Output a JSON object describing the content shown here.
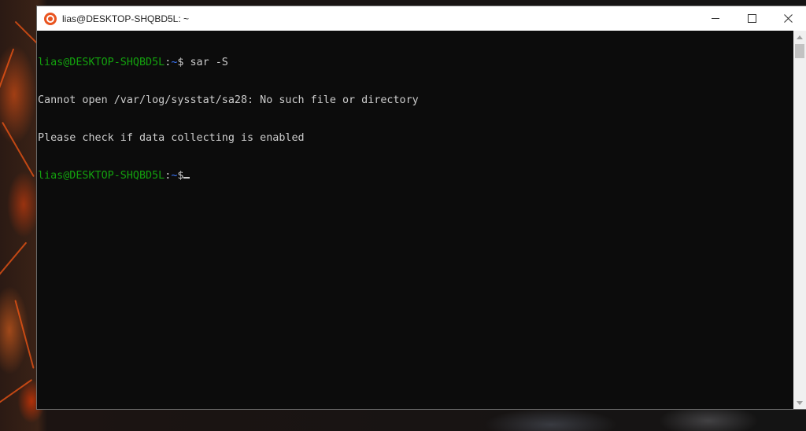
{
  "window": {
    "title": "lias@DESKTOP-SHQBD5L: ~",
    "icon": "ubuntu-logo-icon",
    "accent": "#e95420"
  },
  "caption_buttons": {
    "minimize_icon": "minimize-icon",
    "maximize_icon": "maximize-icon",
    "close_icon": "close-icon"
  },
  "terminal": {
    "colors": {
      "background": "#0c0c0c",
      "foreground": "#cccccc",
      "prompt_user": "#13a10e",
      "prompt_path": "#3b78ff"
    },
    "line1": {
      "user_host": "lias@DESKTOP-SHQBD5L",
      "sep": ":",
      "path": "~",
      "dollar": "$",
      "command": " sar -S"
    },
    "line2": "Cannot open /var/log/sysstat/sa28: No such file or directory",
    "line3": "Please check if data collecting is enabled",
    "line4": {
      "user_host": "lias@DESKTOP-SHQBD5L",
      "sep": ":",
      "path": "~",
      "dollar": "$"
    }
  }
}
